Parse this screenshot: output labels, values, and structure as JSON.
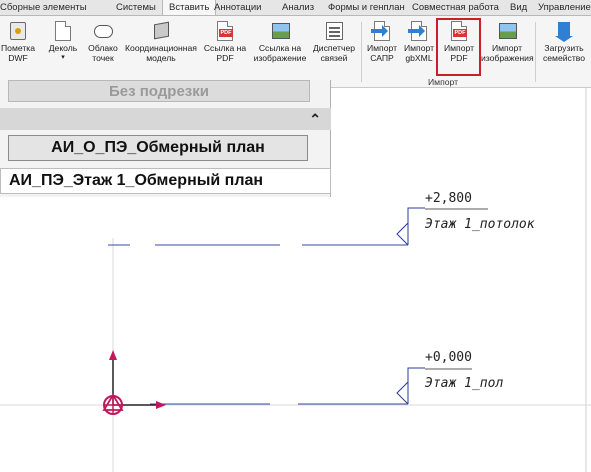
{
  "ribbon": {
    "tabs": [
      "Сборные элементы",
      "Системы",
      "Вставить",
      "Аннотации",
      "Анализ",
      "Формы и генплан",
      "Совместная работа",
      "Вид",
      "Управление"
    ],
    "active_tab": "Вставить",
    "buttons": {
      "dwf": "Пометка DWF",
      "decal": "Деколь",
      "point_cloud": "Облако точек",
      "coord_model": "Координационная модель",
      "pdf_link": "Ссылка на PDF",
      "image_link": "Ссылка на изображение",
      "link_manager": "Диспетчер связей",
      "import_cad": "Импорт САПР",
      "import_gbxml": "Импорт gbXML",
      "import_pdf": "Импорт PDF",
      "import_image": "Импорт изображения",
      "load_family": "Загрузить семейство"
    },
    "group_import": "Импорт"
  },
  "view_panel": {
    "crop_label": "Без подрезки",
    "collapse_icon": "chevron-double-up",
    "view_selected": "АИ_О_ПЭ_Обмерный план",
    "view_other": "АИ_ПЭ_Этаж 1_Обмерный план"
  },
  "levels": [
    {
      "elevation": "+2,800",
      "name": "Этаж 1_потолок"
    },
    {
      "elevation": "+0,000",
      "name": "Этаж 1_пол"
    }
  ],
  "colors": {
    "highlight": "#c8202a",
    "level_line": "#3a4aa8",
    "origin": "#c2185b"
  }
}
